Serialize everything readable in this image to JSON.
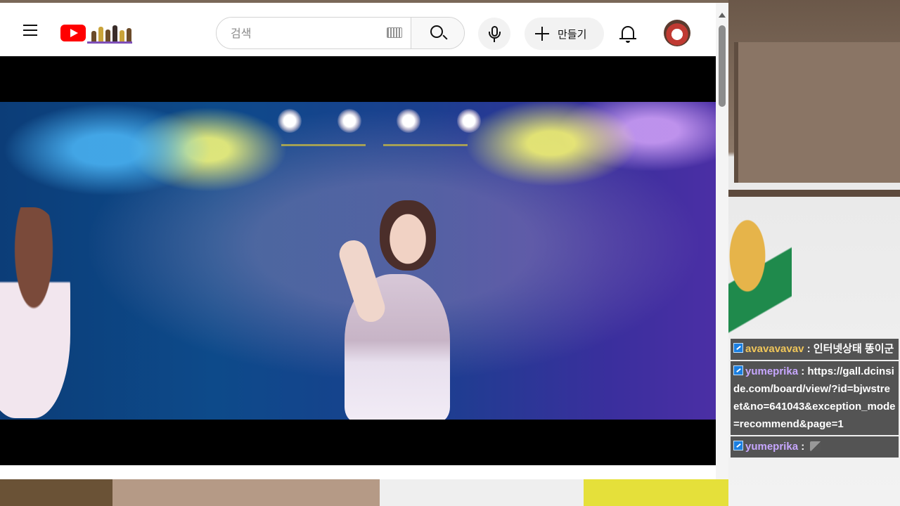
{
  "search": {
    "placeholder": "검색"
  },
  "header": {
    "create_label": "만들기"
  },
  "chat": {
    "messages": [
      {
        "user": "avavavavav",
        "separator": " : ",
        "text": "인터넷상태 똥이군"
      },
      {
        "user": "yumeprika",
        "separator": " : ",
        "text": "https://gall.dcinside.com/board/view/?id=bjwstreet&no=641043&exception_mode=recommend&page=1"
      },
      {
        "user": "yumeprika",
        "separator": " : ",
        "text": ""
      }
    ]
  },
  "colors": {
    "youtube_red": "#ff0000",
    "chat_bg": "#3e3e3e",
    "user1": "#f0c65a",
    "user2": "#c7a7ff"
  },
  "icons": [
    "menu-icon",
    "youtube-logo",
    "keyboard-icon",
    "search-icon",
    "mic-icon",
    "plus-icon",
    "bell-icon",
    "avatar",
    "subscriber-badge-icon",
    "emote-icon"
  ]
}
